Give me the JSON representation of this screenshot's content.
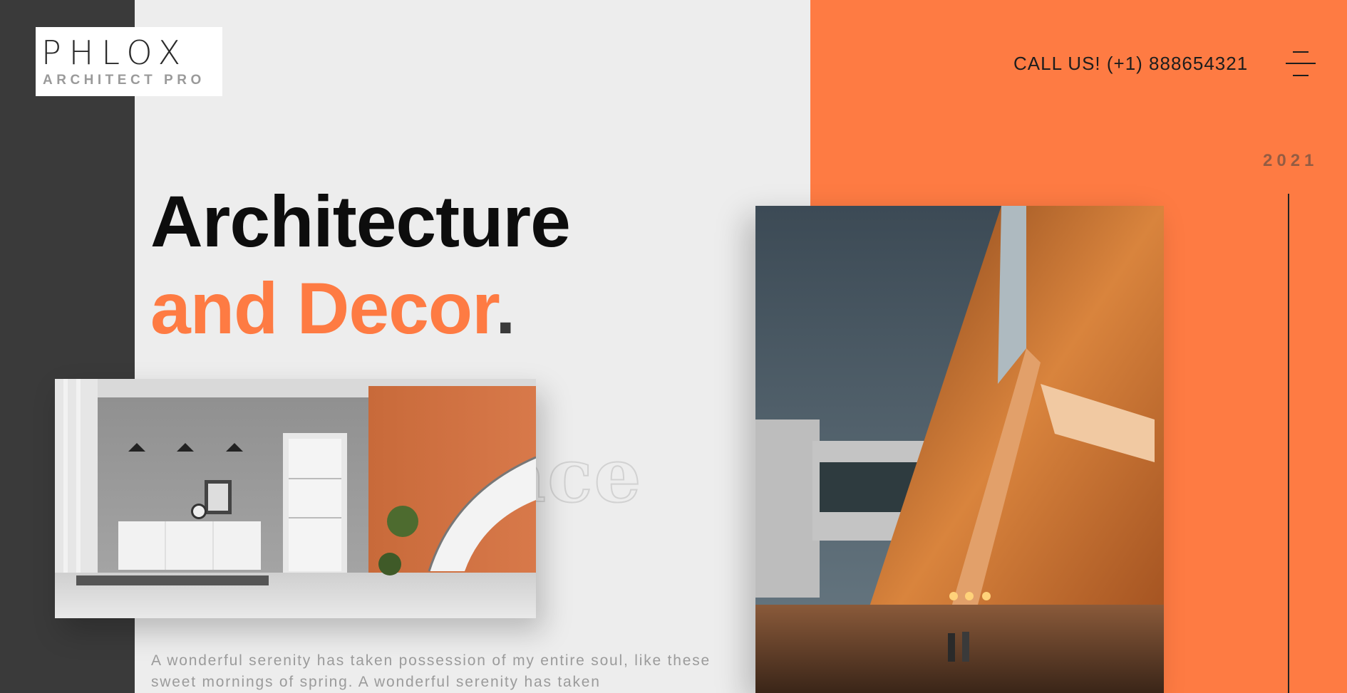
{
  "logo": {
    "main": "PHLOX",
    "sub": "ARCHITECT PRO"
  },
  "header": {
    "call": "CALL US! (+1) 888654321",
    "menu_icon": "hamburger-menu-icon"
  },
  "year": "2021",
  "hero": {
    "line1": "Architecture",
    "line2": "and Decor",
    "line2_dot": ".",
    "outline_word": "pace",
    "paragraph": "A wonderful serenity has taken possession of my entire soul, like these sweet mornings of spring. A wonderful serenity has taken"
  },
  "images": {
    "room": "interior-room-photo",
    "building": "building-exterior-photo"
  },
  "colors": {
    "accent": "#fe7b43",
    "dark": "#3a3a3a",
    "light": "#ededed"
  }
}
